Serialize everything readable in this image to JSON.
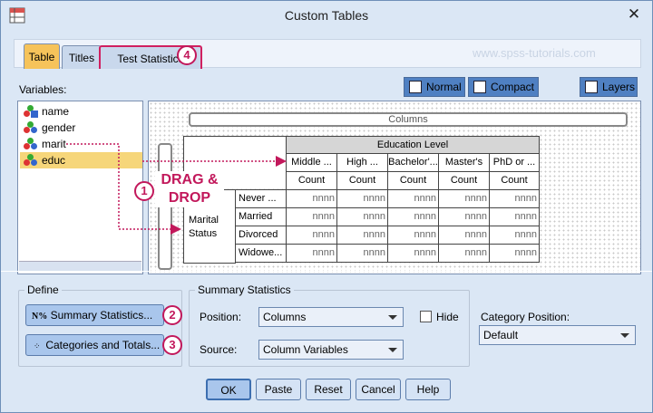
{
  "window": {
    "title": "Custom Tables",
    "close_glyph": "✕"
  },
  "tabs": [
    {
      "label": "Table"
    },
    {
      "label": "Titles"
    },
    {
      "label": "Test Statistics"
    }
  ],
  "watermark": "www.spss-tutorials.com",
  "badges": {
    "one": "1",
    "two": "2",
    "three": "3",
    "four": "4"
  },
  "toolbar": {
    "normal": "Normal",
    "compact": "Compact",
    "layers": "Layers"
  },
  "variables": {
    "label": "Variables:",
    "items": [
      {
        "name": "name"
      },
      {
        "name": "gender"
      },
      {
        "name": "marit"
      },
      {
        "name": "educ"
      }
    ]
  },
  "canvas": {
    "columns_label": "Columns",
    "drag_drop": "DRAG & DROP",
    "table": {
      "col_var": "Education Level",
      "col_cats": [
        "Middle ...",
        "High ...",
        "Bachelor'...",
        "Master's",
        "PhD or ..."
      ],
      "stat": "Count",
      "row_var": "Marital Status",
      "row_cats": [
        "Never ...",
        "Married",
        "Divorced",
        "Widowe..."
      ],
      "cell_value": "nnnn"
    }
  },
  "define": {
    "legend": "Define",
    "summary_btn": "Summary Statistics...",
    "categories_btn": "Categories and Totals...",
    "summary_icon": "N%"
  },
  "summary_statistics": {
    "legend": "Summary Statistics",
    "position_label": "Position:",
    "position_value": "Columns",
    "hide_label": "Hide",
    "source_label": "Source:",
    "source_value": "Column Variables"
  },
  "category_position": {
    "label": "Category Position:",
    "value": "Default"
  },
  "buttons": {
    "ok": "OK",
    "paste": "Paste",
    "reset": "Reset",
    "cancel": "Cancel",
    "help": "Help"
  },
  "colors": {
    "accent": "#c2185b",
    "active_tab": "#f6c35a",
    "selected_item": "#f6d67a"
  }
}
